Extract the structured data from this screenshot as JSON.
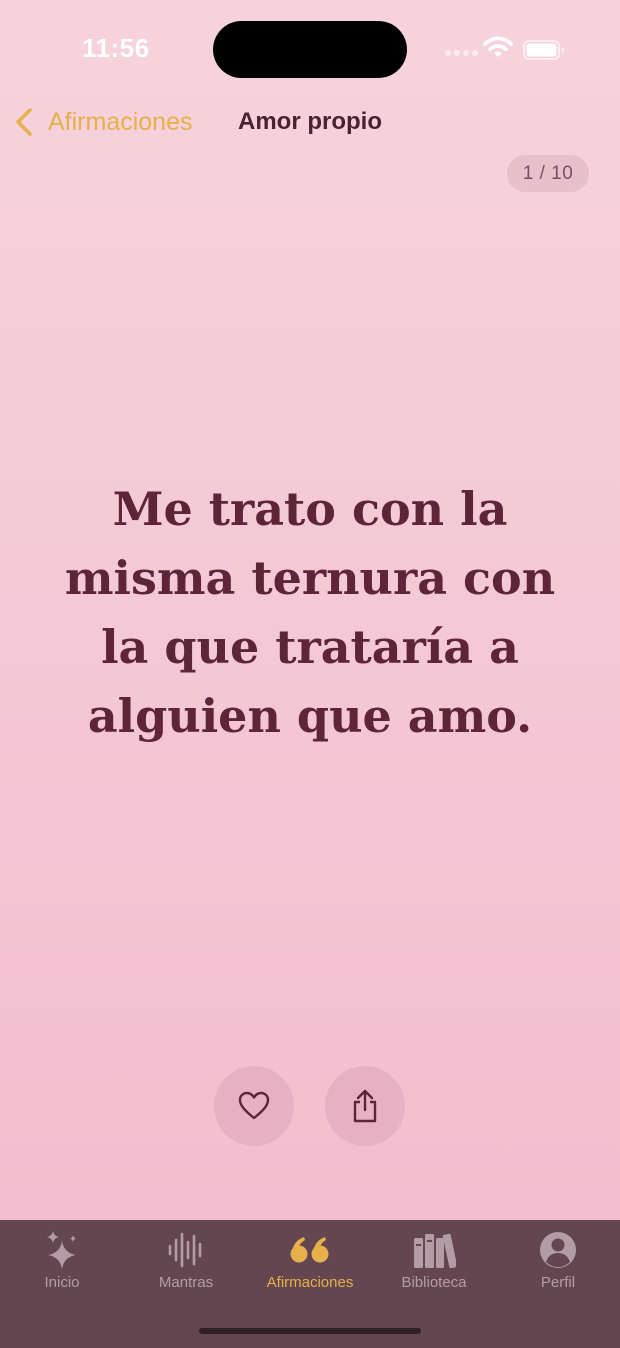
{
  "status": {
    "time": "11:56"
  },
  "nav": {
    "back_label": "Afirmaciones",
    "title": "Amor propio"
  },
  "counter": "1 / 10",
  "affirmation": {
    "text": "Me trato con la misma ternura con la que trataría a alguien que amo."
  },
  "actions": {
    "like_icon": "heart-icon",
    "share_icon": "share-icon"
  },
  "tabs": [
    {
      "label": "Inicio",
      "icon": "sparkles-icon",
      "active": false
    },
    {
      "label": "Mantras",
      "icon": "waveform-icon",
      "active": false
    },
    {
      "label": "Afirmaciones",
      "icon": "quote-icon",
      "active": true
    },
    {
      "label": "Biblioteca",
      "icon": "books-icon",
      "active": false
    },
    {
      "label": "Perfil",
      "icon": "person-circle-icon",
      "active": false
    }
  ],
  "colors": {
    "accent": "#e6b04a",
    "text": "#5e2438",
    "tabbar": "#634650",
    "tab_inactive": "#b49ca6"
  }
}
